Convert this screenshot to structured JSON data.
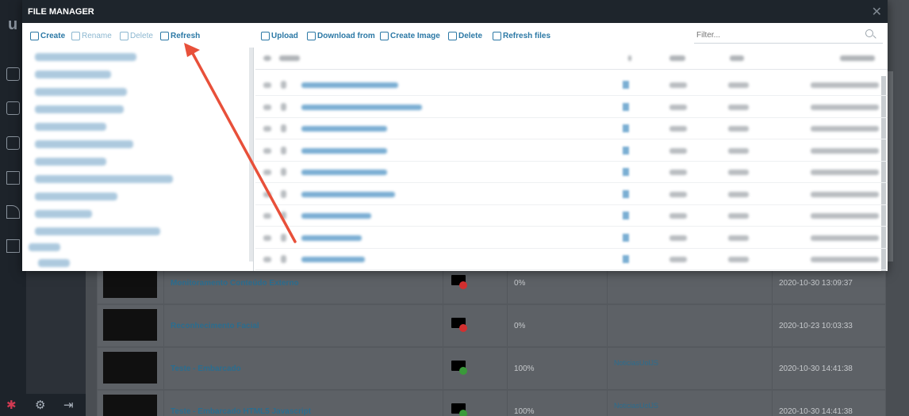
{
  "modal": {
    "title": "FILE MANAGER",
    "close_glyph": "✕"
  },
  "folder_toolbar": [
    {
      "label": "Create",
      "name": "create-folder-button",
      "icon": "folder-plus-icon",
      "disabled": false
    },
    {
      "label": "Rename",
      "name": "rename-folder-button",
      "icon": "folder-edit-icon",
      "disabled": true
    },
    {
      "label": "Delete",
      "name": "delete-folder-button",
      "icon": "folder-delete-icon",
      "disabled": true
    },
    {
      "label": "Refresh",
      "name": "refresh-folder-button",
      "icon": "folder-refresh-icon",
      "disabled": false
    }
  ],
  "file_toolbar": [
    {
      "label": "Upload",
      "name": "upload-button",
      "icon": "upload-icon"
    },
    {
      "label": "Download from",
      "name": "download-from-button",
      "icon": "cloud-download-icon"
    },
    {
      "label": "Create Image",
      "name": "create-image-button",
      "icon": "image-icon"
    },
    {
      "label": "Delete",
      "name": "delete-files-button",
      "icon": "trash-icon"
    },
    {
      "label": "Refresh files",
      "name": "refresh-files-button",
      "icon": "refresh-icon"
    }
  ],
  "filter": {
    "placeholder": "Filter..."
  },
  "background_table": {
    "rows": [
      {
        "name": "Monitoramento Conteúdo Externo",
        "status": "error",
        "progress": "0%",
        "link": "",
        "date": "2020-10-30 13:09:37"
      },
      {
        "name": "Reconhecimento Facial",
        "status": "error",
        "progress": "0%",
        "link": "",
        "date": "2020-10-23 10:03:33"
      },
      {
        "name": "Teste - Embarcado",
        "status": "ok",
        "progress": "100%",
        "link": "NoticiasUolJS",
        "date": "2020-10-30 14:41:38"
      },
      {
        "name": "Teste - Embarcado HTML5 Javascript",
        "status": "ok",
        "progress": "100%",
        "link": "NoticiasUolJS",
        "date": "2020-10-30 14:41:38"
      }
    ]
  },
  "colors": {
    "accent": "#2b78a5",
    "header": "#1e252c",
    "annotation_arrow": "#e8503a"
  }
}
